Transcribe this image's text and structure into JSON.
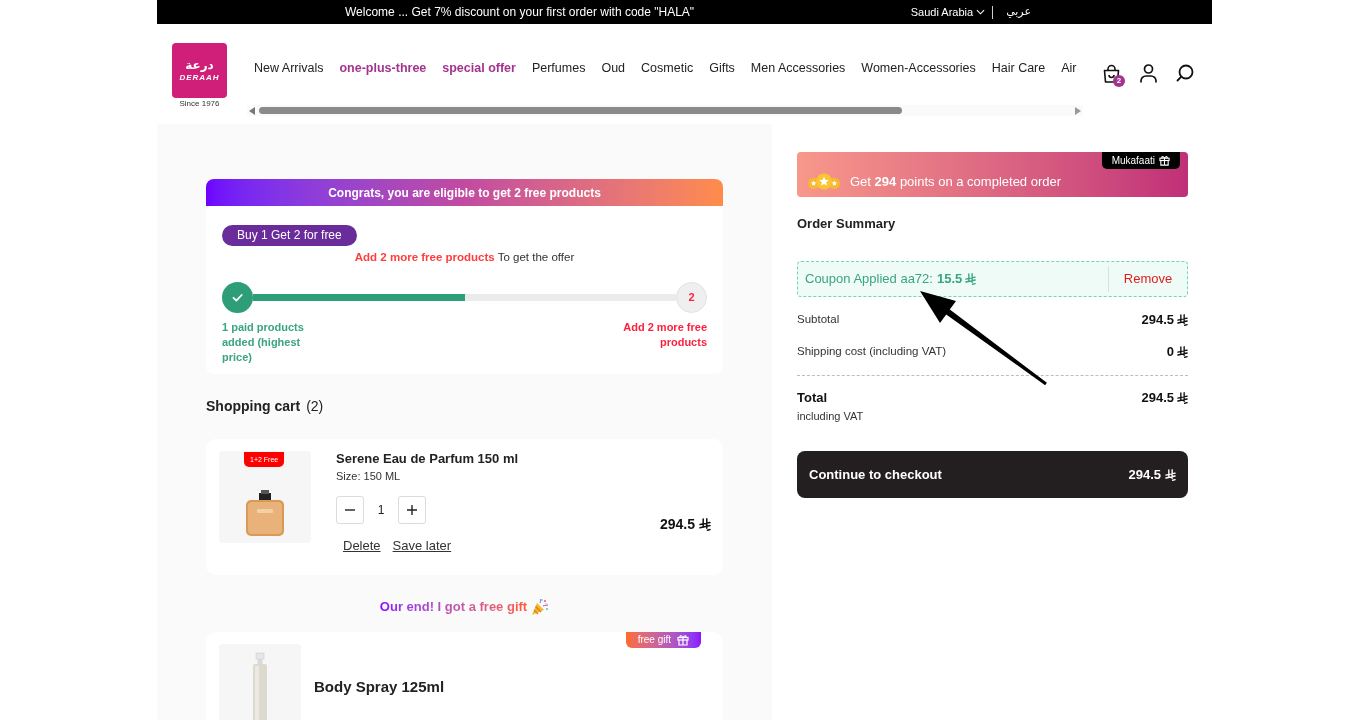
{
  "top_bar": {
    "announcement": "Welcome ... Get 7% discount on your first order with code \"HALA\"",
    "country": "Saudi Arabia",
    "language": "عربي"
  },
  "header": {
    "logo": {
      "arabic": "درعة",
      "name": "DERAAH",
      "tagline": "Since 1976"
    },
    "nav": [
      {
        "label": "New Arrivals",
        "highlighted": false
      },
      {
        "label": "one-plus-three",
        "highlighted": true
      },
      {
        "label": "special offer",
        "highlighted": true
      },
      {
        "label": "Perfumes",
        "highlighted": false
      },
      {
        "label": "Oud",
        "highlighted": false
      },
      {
        "label": "Cosmetic",
        "highlighted": false
      },
      {
        "label": "Gifts",
        "highlighted": false
      },
      {
        "label": "Men Accessories",
        "highlighted": false
      },
      {
        "label": "Women-Accessories",
        "highlighted": false
      },
      {
        "label": "Hair Care",
        "highlighted": false
      },
      {
        "label": "Air",
        "highlighted": false
      }
    ],
    "cart_count": "2"
  },
  "offer": {
    "banner": "Congrats, you are eligible to get 2 free products",
    "badge": "Buy 1 Get 2 for free",
    "message": "**Add 2 more free products** To get the offer",
    "progress": {
      "level": 0.5,
      "end_step": "2",
      "start_label": "1 paid products added (highest price)",
      "end_label": "Add 2 more free products"
    }
  },
  "cart": {
    "title": "Shopping cart",
    "count": "(2)",
    "items": [
      {
        "kind": "product",
        "badge": "1+2 Free",
        "name": "Serene Eau de Parfum 150 ml",
        "size": "Size: 150 ML",
        "quantity": "1",
        "price": "294.5",
        "actions": [
          "Delete",
          "Save later"
        ]
      },
      {
        "kind": "notice",
        "text": "Our end! I got a free gift"
      },
      {
        "kind": "gift",
        "badge": "free gift",
        "name": "Body Spray 125ml"
      }
    ]
  },
  "summary": {
    "points_banner": {
      "tag": "Mukafaati",
      "text": "Get **294** points on a completed order"
    },
    "title": "Order Summary",
    "coupon": {
      "text": "Coupon Applied aa72:",
      "amount": "15.5",
      "action": "Remove"
    },
    "rows": [
      {
        "label": "Subtotal",
        "value": "294.5"
      },
      {
        "label": "Shipping cost (including VAT)",
        "value": "0"
      }
    ],
    "total": {
      "label": "Total",
      "note": "including VAT",
      "value": "294.5"
    },
    "checkout": {
      "label": "Continue to checkout",
      "value": "294.5"
    }
  }
}
